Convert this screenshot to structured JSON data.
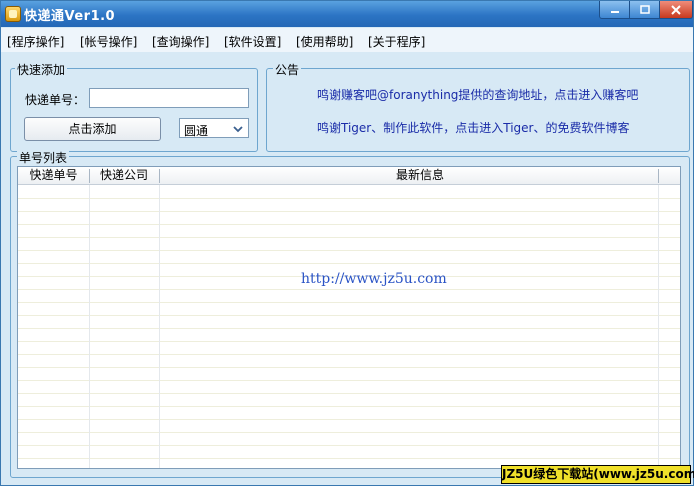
{
  "window": {
    "title": "快递通Ver1.0",
    "controls": [
      "minimize-icon",
      "maximize-icon",
      "close-icon"
    ]
  },
  "menu": [
    "[程序操作]",
    "[帐号操作]",
    "[查询操作]",
    "[软件设置]",
    "[使用帮助]",
    "[关于程序]"
  ],
  "quick_add": {
    "group_title": "快速添加",
    "tracking_label": "快递单号：",
    "tracking_value": "",
    "add_button": "点击添加",
    "company_selected": "圆通"
  },
  "notice": {
    "group_title": "公告",
    "line1": "鸣谢赚客吧@foranything提供的查询地址，点击进入赚客吧",
    "line2": "鸣谢Tiger、制作此软件，点击进入Tiger、的免费软件博客"
  },
  "list": {
    "group_title": "单号列表",
    "columns": [
      "快递单号",
      "快递公司",
      "最新信息"
    ],
    "rows": []
  },
  "watermark": "http://www.jz5u.com",
  "badge": "JZ5U绿色下载站(www.jz5u.com)",
  "colors": {
    "titlebar": "#2c74c4",
    "window_bg": "#d7e9f5",
    "notice_text": "#1a2ca8",
    "badge_bg": "#f0e02a"
  }
}
